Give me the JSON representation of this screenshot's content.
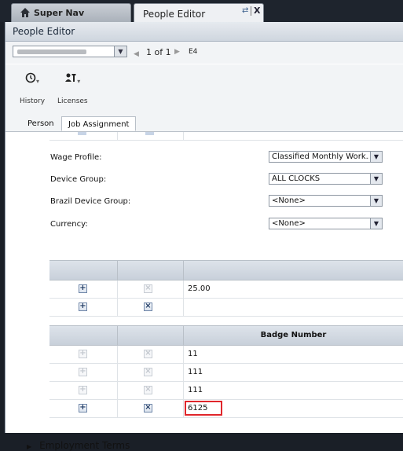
{
  "top_tabs": {
    "super_nav": "Super Nav",
    "people_editor": "People Editor",
    "close": "X"
  },
  "panel": {
    "title": "People Editor"
  },
  "toolbar": {
    "pager_text": "1 of 1",
    "record_code": "E4"
  },
  "actions": {
    "history": "History",
    "licenses": "Licenses"
  },
  "subtabs": {
    "person": "Person",
    "job_assignment": "Job Assignment"
  },
  "fields": {
    "wage_profile": {
      "label": "Wage Profile:",
      "value": "Classified Monthly Work..."
    },
    "device_group": {
      "label": "Device Group:",
      "value": "ALL CLOCKS"
    },
    "brazil_device_group": {
      "label": "Brazil Device Group:",
      "value": "<None>"
    },
    "currency": {
      "label": "Currency:",
      "value": "<None>"
    }
  },
  "rate_grid": {
    "rows": [
      {
        "value": "25.00"
      },
      {
        "value": ""
      }
    ]
  },
  "badge_grid": {
    "header": "Badge Number",
    "rows": [
      {
        "value": "11"
      },
      {
        "value": "111"
      },
      {
        "value": "111"
      },
      {
        "value": "6125"
      }
    ]
  },
  "sections": {
    "employment_terms": "Employment Terms"
  }
}
